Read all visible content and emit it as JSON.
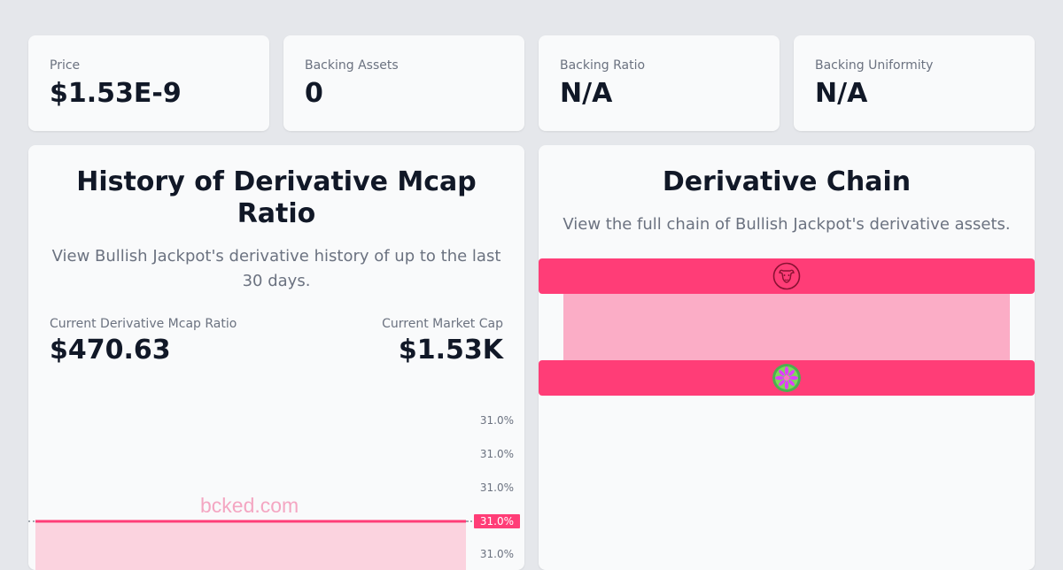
{
  "stats": [
    {
      "label": "Price",
      "value": "$1.53E-9"
    },
    {
      "label": "Backing Assets",
      "value": "0"
    },
    {
      "label": "Backing Ratio",
      "value": "N/A"
    },
    {
      "label": "Backing Uniformity",
      "value": "N/A"
    }
  ],
  "history": {
    "title": "History of Derivative Mcap Ratio",
    "subtitle": "View Bullish Jackpot's derivative history of up to the last 30 days.",
    "ratio_label": "Current Derivative Mcap Ratio",
    "ratio_value": "$470.63",
    "mcap_label": "Current Market Cap",
    "mcap_value": "$1.53K",
    "watermark": "bcked.com"
  },
  "chart_data": {
    "type": "area",
    "y_tick_labels": [
      "31.0%",
      "31.0%",
      "31.0%",
      "31.0%",
      "31.0%"
    ],
    "current_label": "31.0%",
    "series": [
      {
        "values": [
          31.0,
          31.0,
          31.0,
          31.0,
          31.0,
          31.0,
          31.0,
          31.0,
          31.0,
          31.0
        ]
      }
    ],
    "line_color": "#ff3d77",
    "fill_color": "#fbd3df"
  },
  "chain": {
    "title": "Derivative Chain",
    "subtitle": "View the full chain of Bullish Jackpot's derivative assets.",
    "nodes": [
      {
        "icon": "bull-token-icon"
      },
      {
        "icon": "flower-token-icon"
      }
    ],
    "bar_color": "#ff3d77",
    "link_color": "#fbadc6"
  }
}
